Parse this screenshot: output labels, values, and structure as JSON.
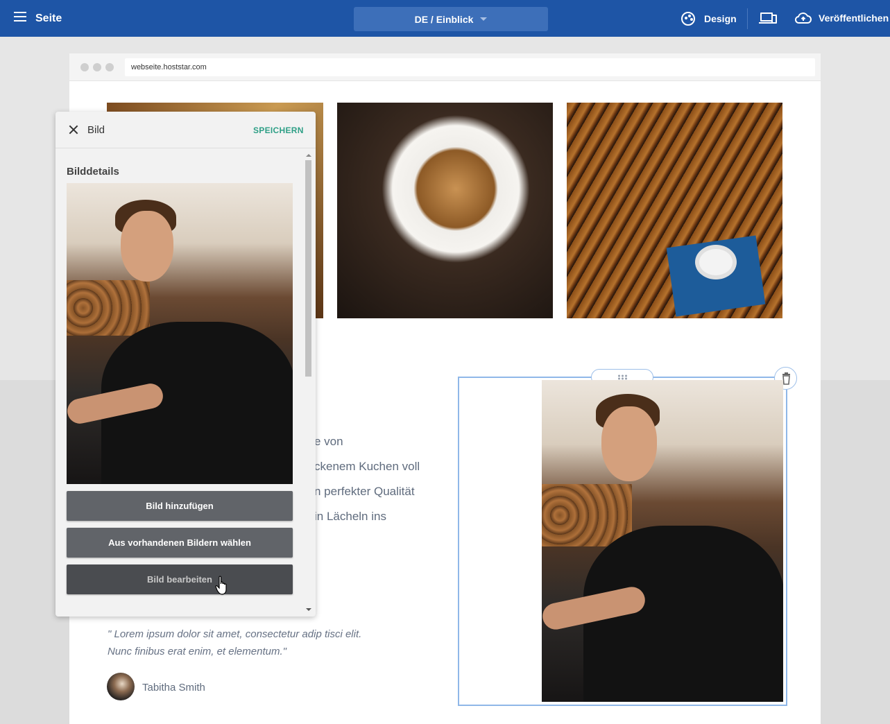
{
  "topbar": {
    "page_label": "Seite",
    "language_selector": "DE / Einblick",
    "design_label": "Design",
    "publish_label": "Veröffentlichen"
  },
  "browser": {
    "url": "webseite.hoststar.com"
  },
  "content": {
    "text_lines": [
      "e von",
      "ckenem Kuchen voll",
      "n perfekter Qualität",
      "in Lächeln ins"
    ],
    "quote": "\" Lorem ipsum dolor sit amet, consectetur adip tisci elit. Nunc finibus erat enim, et elementum.\"",
    "author_name": "Tabitha Smith"
  },
  "panel": {
    "title": "Bild",
    "save_label": "SPEICHERN",
    "section_label": "Bilddetails",
    "buttons": [
      {
        "label": "Bild hinzufügen"
      },
      {
        "label": "Aus vorhandenen Bildern wählen"
      },
      {
        "label": "Bild bearbeiten"
      }
    ]
  },
  "colors": {
    "topbar": "#1e55a6",
    "accent_save": "#2e9f86",
    "selection": "#8fb7e8"
  },
  "icons": [
    "menu-icon",
    "palette-icon",
    "devices-icon",
    "cloud-upload-icon",
    "close-icon",
    "drag-handle-icon",
    "trash-icon",
    "hand-cursor-icon"
  ]
}
